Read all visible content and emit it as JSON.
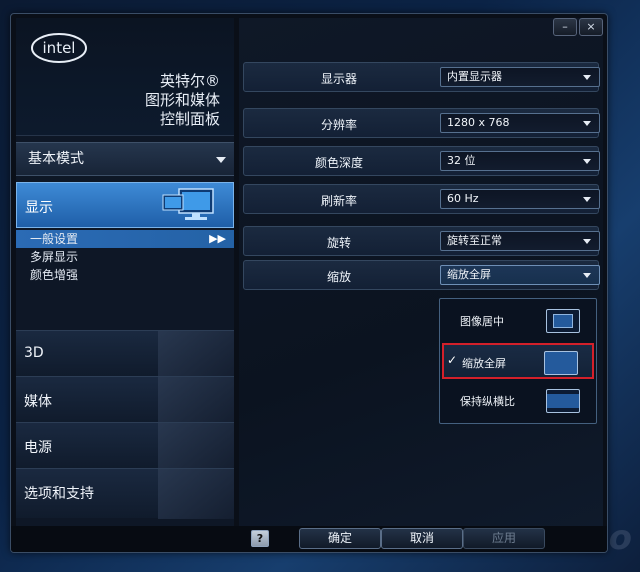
{
  "window": {
    "buttons": {
      "minimize": "–",
      "close": "×"
    }
  },
  "brand": {
    "logo_text": "intel",
    "title_lines": [
      "英特尔®",
      "图形和媒体",
      "控制面板"
    ]
  },
  "mode_select": {
    "value": "基本模式"
  },
  "categories": {
    "display": "显示",
    "sub_items": [
      "一般设置",
      "多屏显示",
      "颜色增强"
    ],
    "active_sub_arrow": "▶▶",
    "others": [
      "3D",
      "媒体",
      "电源",
      "选项和支持"
    ]
  },
  "settings": {
    "display_device": {
      "label": "显示器",
      "value": "内置显示器"
    },
    "resolution": {
      "label": "分辨率",
      "value": "1280 x 768"
    },
    "color_depth": {
      "label": "颜色深度",
      "value": "32 位"
    },
    "refresh_rate": {
      "label": "刷新率",
      "value": "60 Hz"
    },
    "rotation": {
      "label": "旋转",
      "value": "旋转至正常"
    },
    "scaling": {
      "label": "缩放",
      "value": "缩放全屏"
    }
  },
  "scaling_options": [
    {
      "label": "图像居中",
      "selected": false
    },
    {
      "label": "缩放全屏",
      "selected": true
    },
    {
      "label": "保持纵横比",
      "selected": false
    }
  ],
  "checkmark": "✓",
  "footer": {
    "help": "?",
    "ok": "确定",
    "cancel": "取消",
    "apply": "应用"
  },
  "watermark": "lenovo",
  "colors": {
    "accent": "#2b6bb5",
    "highlight_border": "#d4202a"
  }
}
